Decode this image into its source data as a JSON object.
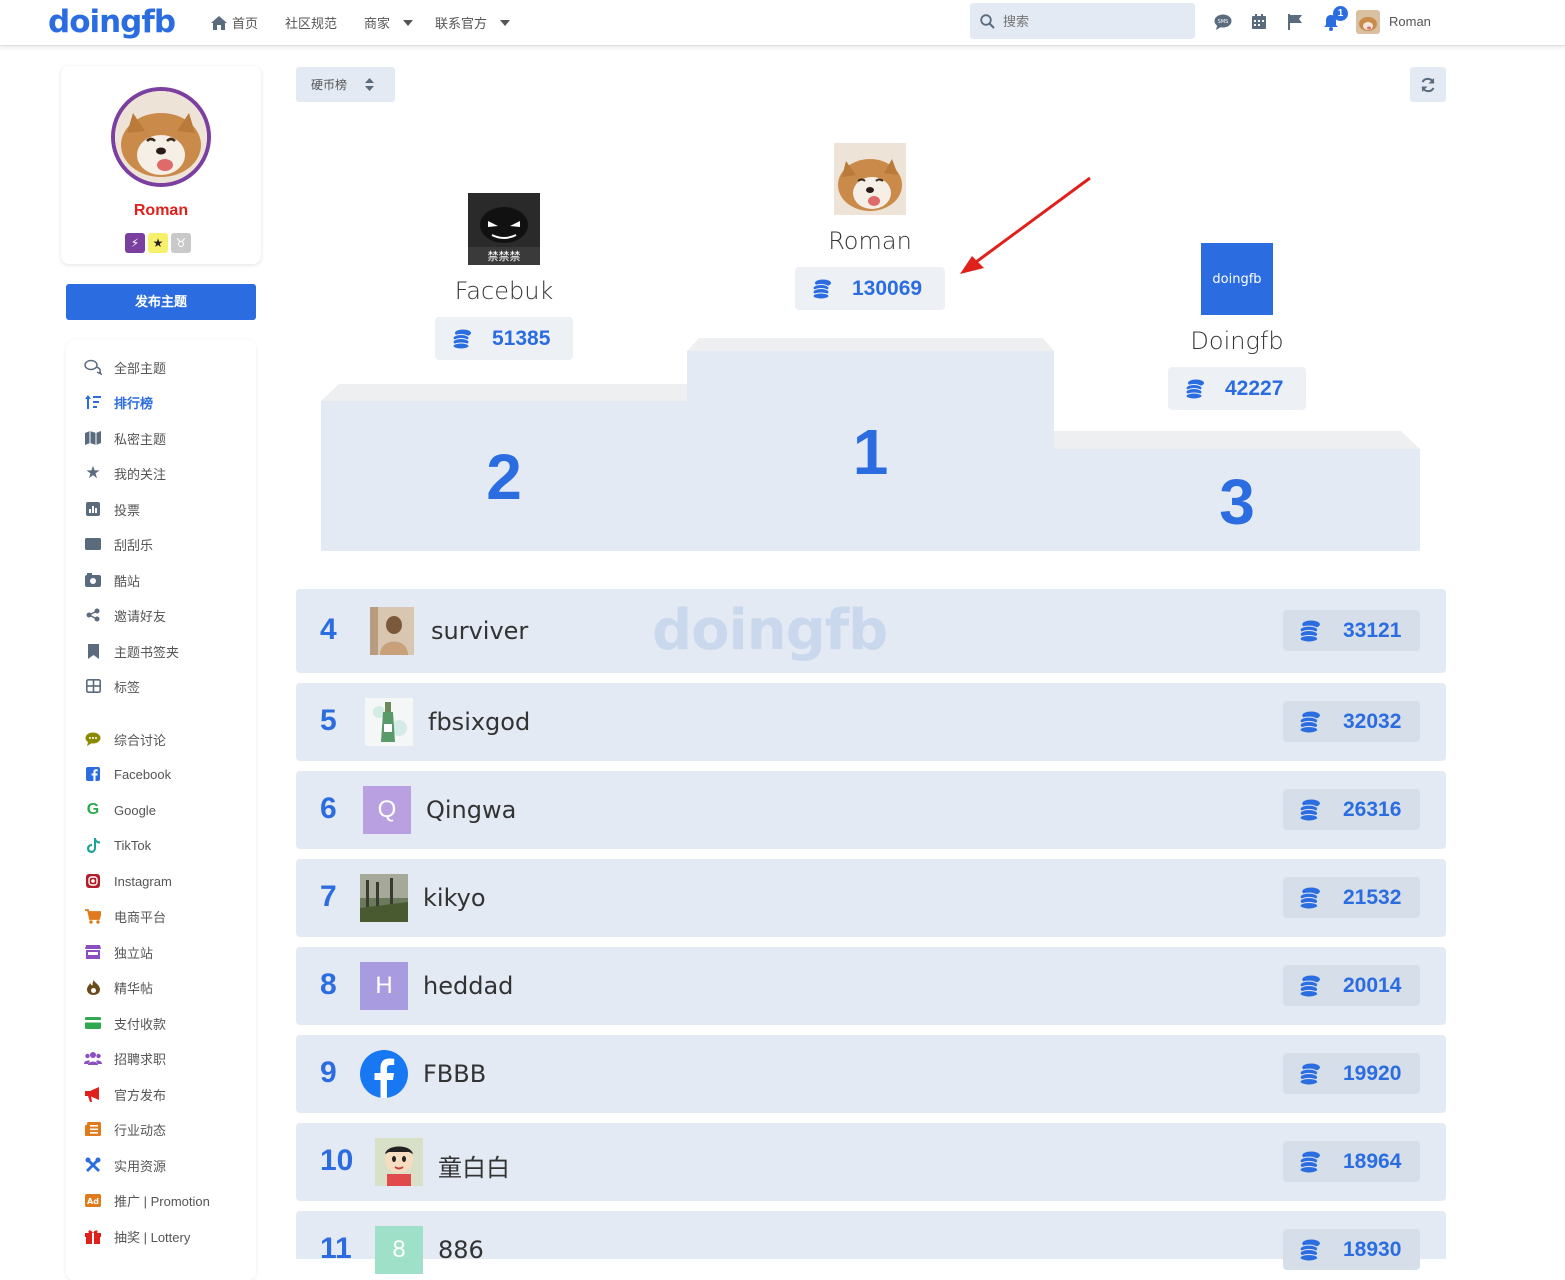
{
  "header": {
    "logo": "doingfb",
    "nav": [
      {
        "label": "首页",
        "icon": "home-icon"
      },
      {
        "label": "社区规范"
      },
      {
        "label": "商家",
        "dropdown": true
      },
      {
        "label": "联系官方",
        "dropdown": true
      }
    ],
    "search_placeholder": "搜索",
    "notification_count": "1",
    "username": "Roman"
  },
  "sidebar": {
    "profile_name": "Roman",
    "publish_label": "发布主题",
    "menu": [
      {
        "label": "全部主题",
        "icon": "chat-bubbles-icon"
      },
      {
        "label": "排行榜",
        "icon": "sort-icon",
        "active": true
      },
      {
        "label": "私密主题",
        "icon": "map-icon"
      },
      {
        "label": "我的关注",
        "icon": "star-icon"
      },
      {
        "label": "投票",
        "icon": "poll-icon"
      },
      {
        "label": "刮刮乐",
        "icon": "ticket-icon"
      },
      {
        "label": "酷站",
        "icon": "camera-icon"
      },
      {
        "label": "邀请好友",
        "icon": "share-icon"
      },
      {
        "label": "主题书签夹",
        "icon": "bookmark-icon"
      },
      {
        "label": "标签",
        "icon": "grid-icon"
      },
      {
        "label": "综合讨论",
        "icon": "comment-icon",
        "color": "#8a8a00"
      },
      {
        "label": "Facebook",
        "icon": "facebook-icon",
        "color": "#2b6de0"
      },
      {
        "label": "Google",
        "icon": "google-icon",
        "color": "#2fa84f"
      },
      {
        "label": "TikTok",
        "icon": "tiktok-icon",
        "color": "#1aa39a"
      },
      {
        "label": "Instagram",
        "icon": "instagram-icon",
        "color": "#b21e2a"
      },
      {
        "label": "电商平台",
        "icon": "cart-icon",
        "color": "#e07a1a"
      },
      {
        "label": "独立站",
        "icon": "store-icon",
        "color": "#8b4fc0"
      },
      {
        "label": "精华帖",
        "icon": "fire-icon",
        "color": "#6a4a1a"
      },
      {
        "label": "支付收款",
        "icon": "card-icon",
        "color": "#2fa84f"
      },
      {
        "label": "招聘求职",
        "icon": "users-icon",
        "color": "#8b4fc0"
      },
      {
        "label": "官方发布",
        "icon": "megaphone-icon",
        "color": "#e0201b"
      },
      {
        "label": "行业动态",
        "icon": "newspaper-icon",
        "color": "#e07a1a"
      },
      {
        "label": "实用资源",
        "icon": "tools-icon",
        "color": "#2b6de0"
      },
      {
        "label": "推广 | Promotion",
        "icon": "ad-icon",
        "color": "#e07a1a"
      },
      {
        "label": "抽奖 | Lottery",
        "icon": "gift-icon",
        "color": "#e0201b"
      }
    ]
  },
  "main": {
    "sort_label": "硬币榜",
    "watermark": "doingfb",
    "podium": [
      {
        "rank": "2",
        "name": "Facebuk",
        "coins": "51385",
        "avatar_text": "禁禁禁"
      },
      {
        "rank": "1",
        "name": "Roman",
        "coins": "130069"
      },
      {
        "rank": "3",
        "name": "Doingfb",
        "coins": "42227",
        "avatar_text": "doingfb"
      }
    ],
    "rows": [
      {
        "rank": "4",
        "name": "surviver",
        "coins": "33121"
      },
      {
        "rank": "5",
        "name": "fbsixgod",
        "coins": "32032"
      },
      {
        "rank": "6",
        "name": "Qingwa",
        "coins": "26316",
        "initial": "Q",
        "color": "#b9a0e0"
      },
      {
        "rank": "7",
        "name": "kikyo",
        "coins": "21532"
      },
      {
        "rank": "8",
        "name": "heddad",
        "coins": "20014",
        "initial": "H",
        "color": "#a99be0"
      },
      {
        "rank": "9",
        "name": "FBBB",
        "coins": "19920"
      },
      {
        "rank": "10",
        "name": "童白白",
        "coins": "18964"
      },
      {
        "rank": "11",
        "name": "886",
        "coins": "18930",
        "initial": "8",
        "color": "#9fe0c8"
      }
    ]
  }
}
